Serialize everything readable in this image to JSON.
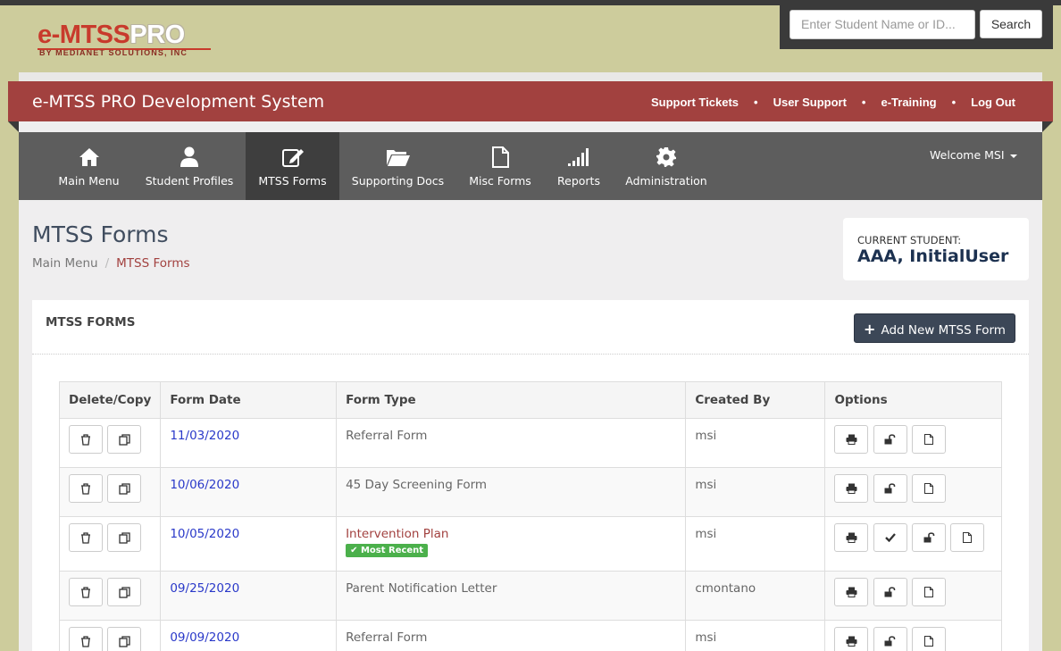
{
  "logo": {
    "main_e": "e-",
    "main_mtss": "MTSS",
    "main_pro": "PRO",
    "sub": "BY MEDIANET SOLUTIONS, INC"
  },
  "search": {
    "placeholder": "Enter Student Name or ID...",
    "button": "Search"
  },
  "banner": {
    "title": "e-MTSS PRO Development System",
    "links": [
      "Support Tickets",
      "User Support",
      "e-Training",
      "Log Out"
    ],
    "separator": "•"
  },
  "nav": {
    "items": [
      {
        "label": "Main Menu",
        "icon": "home-icon"
      },
      {
        "label": "Student Profiles",
        "icon": "user-icon"
      },
      {
        "label": "MTSS Forms",
        "icon": "edit-icon",
        "active": true
      },
      {
        "label": "Supporting Docs",
        "icon": "folder-icon"
      },
      {
        "label": "Misc Forms",
        "icon": "file-icon"
      },
      {
        "label": "Reports",
        "icon": "signal-icon"
      },
      {
        "label": "Administration",
        "icon": "gear-icon"
      }
    ],
    "welcome": "Welcome MSI"
  },
  "page": {
    "title": "MTSS Forms",
    "breadcrumb": [
      "Main Menu",
      "MTSS Forms"
    ],
    "breadcrumb_sep": "/"
  },
  "student": {
    "label": "CURRENT STUDENT:",
    "name": "AAA, InitialUser"
  },
  "panel": {
    "title": "MTSS FORMS",
    "add_button": "Add New MTSS Form",
    "add_icon": "+"
  },
  "table": {
    "headers": [
      "Delete/Copy",
      "Form Date",
      "Form Type",
      "Created By",
      "Options"
    ],
    "rows": [
      {
        "date": "11/03/2020",
        "type": "Referral Form",
        "created_by": "msi"
      },
      {
        "date": "10/06/2020",
        "type": "45 Day Screening Form",
        "created_by": "msi"
      },
      {
        "date": "10/05/2020",
        "type": "Intervention Plan",
        "created_by": "msi",
        "badge": "Most Recent"
      },
      {
        "date": "09/25/2020",
        "type": "Parent Notification Letter",
        "created_by": "cmontano"
      },
      {
        "date": "09/09/2020",
        "type": "Referral Form",
        "created_by": "msi"
      }
    ]
  },
  "colors": {
    "banner": "#a2413f",
    "nav": "#5d5d5d",
    "nav_active": "#3e3e3e",
    "page_bg": "#cdcc9c",
    "badge": "#4bb04b",
    "link": "#2a39c9"
  }
}
